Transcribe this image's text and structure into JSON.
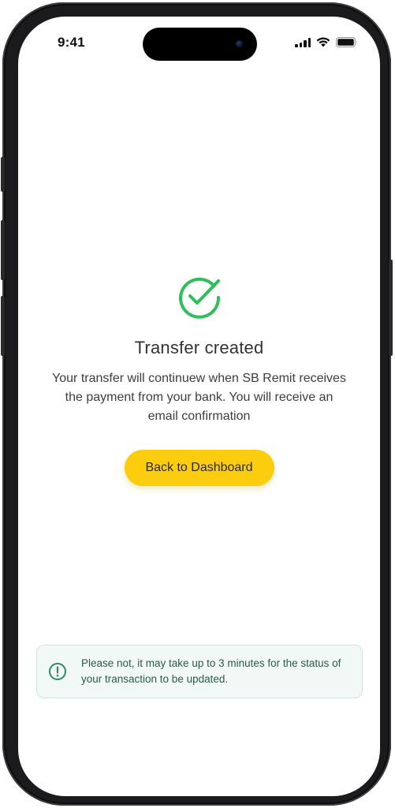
{
  "status_bar": {
    "time": "9:41",
    "icons": [
      "signal-icon",
      "wifi-icon",
      "battery-icon"
    ]
  },
  "result": {
    "icon": "check-circle-icon",
    "title": "Transfer created",
    "message": "Your transfer will continuew when SB Remit receives the payment from your bank. You will receive an email confirmation"
  },
  "actions": {
    "back_label": "Back to Dashboard"
  },
  "notice": {
    "icon": "info-circle-icon",
    "text": "Please not, it may take up to 3 minutes for the status of your transaction to be updated."
  },
  "colors": {
    "success": "#2fbe5a",
    "accent": "#fccc0f",
    "notice_bg": "#f1f8f5",
    "notice_border": "#cfe6dc",
    "notice_text": "#2d5a4a"
  }
}
